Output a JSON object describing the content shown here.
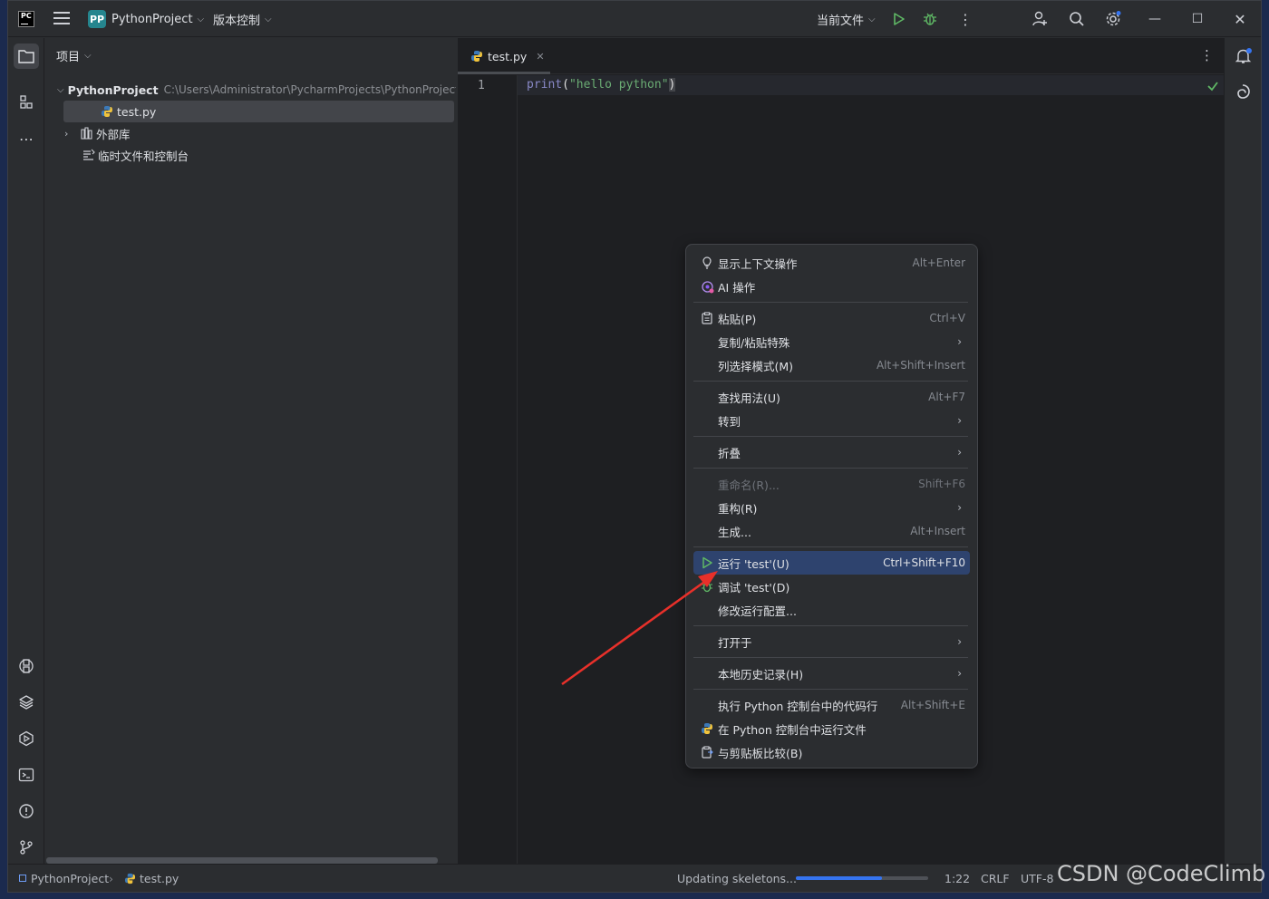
{
  "titlebar": {
    "logo_text": "PC",
    "project_badge": "PP",
    "project_name": "PythonProject",
    "vcs_label": "版本控制",
    "run_config": "当前文件"
  },
  "project_panel": {
    "header": "项目",
    "root_name": "PythonProject",
    "root_path": "C:\\Users\\Administrator\\PycharmProjects\\PythonProject",
    "file_name": "test.py",
    "external_libs": "外部库",
    "scratches": "临时文件和控制台"
  },
  "editor": {
    "tab_name": "test.py",
    "line_number": "1",
    "code_fn": "print",
    "code_open": "(",
    "code_str": "\"hello python\"",
    "code_close": ")"
  },
  "context_menu": {
    "items": [
      {
        "label": "显示上下文操作",
        "shortcut": "Alt+Enter"
      },
      {
        "label": "AI 操作",
        "shortcut": ""
      },
      {
        "label": "粘贴(P)",
        "shortcut": "Ctrl+V"
      },
      {
        "label": "复制/粘贴特殊",
        "shortcut": ""
      },
      {
        "label": "列选择模式(M)",
        "shortcut": "Alt+Shift+Insert"
      },
      {
        "label": "查找用法(U)",
        "shortcut": "Alt+F7"
      },
      {
        "label": "转到",
        "shortcut": ""
      },
      {
        "label": "折叠",
        "shortcut": ""
      },
      {
        "label": "重命名(R)...",
        "shortcut": "Shift+F6"
      },
      {
        "label": "重构(R)",
        "shortcut": ""
      },
      {
        "label": "生成...",
        "shortcut": "Alt+Insert"
      },
      {
        "label": "运行 'test'(U)",
        "shortcut": "Ctrl+Shift+F10"
      },
      {
        "label": "调试 'test'(D)",
        "shortcut": ""
      },
      {
        "label": "修改运行配置...",
        "shortcut": ""
      },
      {
        "label": "打开于",
        "shortcut": ""
      },
      {
        "label": "本地历史记录(H)",
        "shortcut": ""
      },
      {
        "label": "执行 Python 控制台中的代码行",
        "shortcut": "Alt+Shift+E"
      },
      {
        "label": "在 Python 控制台中运行文件",
        "shortcut": ""
      },
      {
        "label": "与剪贴板比较(B)",
        "shortcut": ""
      }
    ]
  },
  "statusbar": {
    "project": "PythonProject",
    "file": "test.py",
    "task": "Updating skeletons...",
    "progress": 0.65,
    "position": "1:22",
    "line_sep": "CRLF",
    "encoding": "UTF-8"
  },
  "watermark": "CSDN @CodeClimb",
  "colors": {
    "accent": "#3574f0",
    "run_green": "#5fb865",
    "highlight": "#2e436e"
  }
}
